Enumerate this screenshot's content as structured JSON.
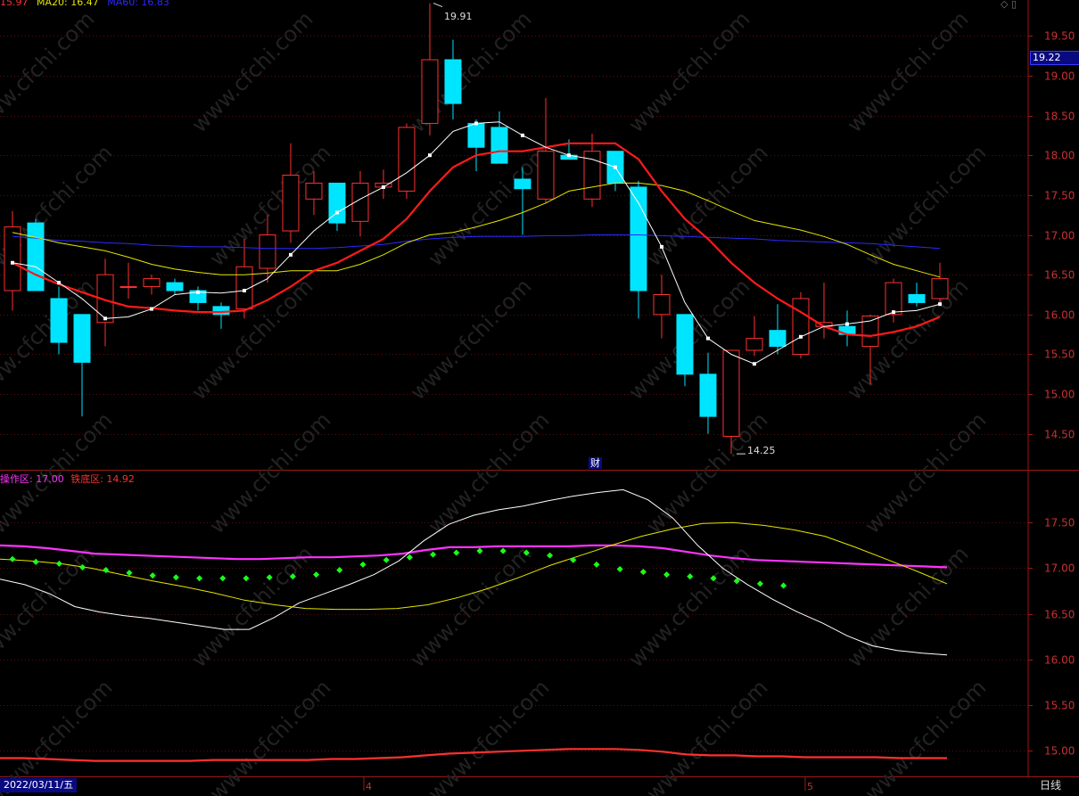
{
  "chart_data": [
    {
      "type": "candlestick",
      "legend": [
        {
          "label": "15.97",
          "color": "#ff3030"
        },
        {
          "label": "MA20: 16.47",
          "color": "#e6e600"
        },
        {
          "label": "MA60: 16.83",
          "color": "#2a2aff"
        }
      ],
      "current_price_label": "19.22",
      "max_label": "19.91",
      "min_label": "14.25",
      "finance_marker": "财",
      "y_ticks": [
        "19.50",
        "19.00",
        "18.50",
        "18.00",
        "17.50",
        "17.00",
        "16.50",
        "16.00",
        "15.50",
        "15.00",
        "14.50"
      ],
      "ylim": [
        14.05,
        19.95
      ],
      "colors": {
        "up": "#ff3030",
        "down": "#00e5ff",
        "ma5": "#ffffff",
        "ma10": "#ff1a1a",
        "ma20": "#e6e600",
        "ma60": "#2a2aff"
      },
      "candles": [
        {
          "o": 16.3,
          "h": 17.3,
          "l": 16.05,
          "c": 17.1
        },
        {
          "o": 17.15,
          "h": 17.2,
          "l": 16.3,
          "c": 16.3
        },
        {
          "o": 16.2,
          "h": 16.35,
          "l": 15.5,
          "c": 15.65
        },
        {
          "o": 16.0,
          "h": 16.0,
          "l": 14.72,
          "c": 15.4
        },
        {
          "o": 15.9,
          "h": 16.7,
          "l": 15.6,
          "c": 16.5
        },
        {
          "o": 16.35,
          "h": 16.65,
          "l": 16.2,
          "c": 16.35
        },
        {
          "o": 16.35,
          "h": 16.5,
          "l": 16.25,
          "c": 16.45
        },
        {
          "o": 16.4,
          "h": 16.45,
          "l": 16.25,
          "c": 16.3
        },
        {
          "o": 16.3,
          "h": 16.35,
          "l": 16.05,
          "c": 16.15
        },
        {
          "o": 16.1,
          "h": 16.15,
          "l": 15.82,
          "c": 16.0
        },
        {
          "o": 16.07,
          "h": 16.95,
          "l": 15.95,
          "c": 16.6
        },
        {
          "o": 16.58,
          "h": 17.25,
          "l": 16.4,
          "c": 17.0
        },
        {
          "o": 17.05,
          "h": 18.15,
          "l": 16.9,
          "c": 17.75
        },
        {
          "o": 17.45,
          "h": 17.8,
          "l": 17.25,
          "c": 17.65
        },
        {
          "o": 17.65,
          "h": 17.65,
          "l": 17.05,
          "c": 17.15
        },
        {
          "o": 17.17,
          "h": 17.8,
          "l": 16.98,
          "c": 17.65
        },
        {
          "o": 17.6,
          "h": 17.82,
          "l": 17.45,
          "c": 17.65
        },
        {
          "o": 17.55,
          "h": 18.4,
          "l": 17.45,
          "c": 18.35
        },
        {
          "o": 18.4,
          "h": 19.91,
          "l": 18.25,
          "c": 19.2
        },
        {
          "o": 19.2,
          "h": 19.45,
          "l": 18.45,
          "c": 18.65
        },
        {
          "o": 18.4,
          "h": 18.45,
          "l": 17.8,
          "c": 18.1
        },
        {
          "o": 18.35,
          "h": 18.55,
          "l": 17.9,
          "c": 17.9
        },
        {
          "o": 17.7,
          "h": 17.85,
          "l": 17.0,
          "c": 17.58
        },
        {
          "o": 17.45,
          "h": 18.72,
          "l": 17.4,
          "c": 18.05
        },
        {
          "o": 18.0,
          "h": 18.2,
          "l": 17.95,
          "c": 17.95
        },
        {
          "o": 17.45,
          "h": 18.27,
          "l": 17.35,
          "c": 18.05
        },
        {
          "o": 18.05,
          "h": 18.05,
          "l": 17.55,
          "c": 17.65
        },
        {
          "o": 17.6,
          "h": 17.68,
          "l": 15.95,
          "c": 16.3
        },
        {
          "o": 16.0,
          "h": 16.5,
          "l": 15.7,
          "c": 16.25
        },
        {
          "o": 16.0,
          "h": 16.0,
          "l": 15.1,
          "c": 15.25
        },
        {
          "o": 15.25,
          "h": 15.52,
          "l": 14.5,
          "c": 14.72
        },
        {
          "o": 14.47,
          "h": 15.55,
          "l": 14.25,
          "c": 15.55
        },
        {
          "o": 15.55,
          "h": 15.98,
          "l": 15.48,
          "c": 15.7
        },
        {
          "o": 15.8,
          "h": 16.13,
          "l": 15.5,
          "c": 15.6
        },
        {
          "o": 15.5,
          "h": 16.28,
          "l": 15.45,
          "c": 16.2
        },
        {
          "o": 15.85,
          "h": 16.4,
          "l": 15.7,
          "c": 15.9
        },
        {
          "o": 15.85,
          "h": 16.05,
          "l": 15.6,
          "c": 15.75
        },
        {
          "o": 15.6,
          "h": 16.0,
          "l": 15.12,
          "c": 15.98
        },
        {
          "o": 16.0,
          "h": 16.45,
          "l": 15.9,
          "c": 16.4
        },
        {
          "o": 16.25,
          "h": 16.4,
          "l": 16.1,
          "c": 16.15
        },
        {
          "o": 16.2,
          "h": 16.65,
          "l": 16.15,
          "c": 16.45
        }
      ],
      "ma5": [
        16.65,
        16.6,
        16.4,
        16.2,
        15.95,
        15.97,
        16.07,
        16.25,
        16.28,
        16.27,
        16.3,
        16.45,
        16.75,
        17.05,
        17.28,
        17.45,
        17.6,
        17.78,
        18.0,
        18.3,
        18.4,
        18.42,
        18.25,
        18.1,
        18.0,
        17.95,
        17.85,
        17.4,
        16.85,
        16.15,
        15.7,
        15.5,
        15.38,
        15.55,
        15.72,
        15.85,
        15.88,
        15.92,
        16.03,
        16.05,
        16.13
      ],
      "ma10": [
        16.65,
        16.5,
        16.38,
        16.28,
        16.18,
        16.1,
        16.08,
        16.05,
        16.03,
        16.03,
        16.05,
        16.18,
        16.35,
        16.55,
        16.65,
        16.8,
        16.95,
        17.2,
        17.55,
        17.85,
        18.0,
        18.05,
        18.05,
        18.1,
        18.15,
        18.15,
        18.15,
        17.95,
        17.55,
        17.2,
        16.95,
        16.65,
        16.4,
        16.2,
        16.03,
        15.85,
        15.75,
        15.73,
        15.78,
        15.85,
        15.97
      ],
      "ma20": [
        17.03,
        16.97,
        16.9,
        16.85,
        16.8,
        16.72,
        16.63,
        16.57,
        16.53,
        16.5,
        16.5,
        16.52,
        16.55,
        16.55,
        16.55,
        16.63,
        16.75,
        16.9,
        17.0,
        17.03,
        17.1,
        17.18,
        17.28,
        17.4,
        17.55,
        17.6,
        17.65,
        17.65,
        17.62,
        17.55,
        17.43,
        17.3,
        17.18,
        17.12,
        17.06,
        16.98,
        16.88,
        16.75,
        16.63,
        16.55,
        16.47
      ],
      "ma60": [
        16.98,
        16.96,
        16.93,
        16.92,
        16.9,
        16.89,
        16.87,
        16.86,
        16.85,
        16.85,
        16.84,
        16.83,
        16.83,
        16.83,
        16.84,
        16.86,
        16.88,
        16.92,
        16.95,
        16.97,
        16.98,
        16.98,
        16.98,
        16.99,
        16.99,
        17.0,
        17.0,
        17.0,
        16.99,
        16.98,
        16.97,
        16.96,
        16.95,
        16.93,
        16.92,
        16.91,
        16.9,
        16.89,
        16.87,
        16.85,
        16.83
      ]
    },
    {
      "type": "line",
      "legend": [
        {
          "label": "操作区: 17.00",
          "color": "#ff33ff"
        },
        {
          "label": "铁底区: 14.92",
          "color": "#ff3030"
        }
      ],
      "y_ticks": [
        "17.50",
        "17.00",
        "16.50",
        "16.00",
        "15.50",
        "15.00"
      ],
      "ylim": [
        14.72,
        18.03
      ],
      "series": [
        {
          "name": "操作区",
          "color": "#ff33ff",
          "values": [
            17.25,
            17.24,
            17.22,
            17.19,
            17.16,
            17.15,
            17.14,
            17.13,
            17.12,
            17.11,
            17.1,
            17.1,
            17.11,
            17.12,
            17.12,
            17.13,
            17.14,
            17.16,
            17.2,
            17.23,
            17.23,
            17.24,
            17.24,
            17.24,
            17.24,
            17.25,
            17.25,
            17.24,
            17.22,
            17.18,
            17.14,
            17.11,
            17.09,
            17.08,
            17.07,
            17.06,
            17.05,
            17.04,
            17.03,
            17.02,
            17.01
          ]
        },
        {
          "name": "铁底区",
          "color": "#ff3030",
          "values": [
            14.92,
            14.92,
            14.91,
            14.9,
            14.89,
            14.89,
            14.89,
            14.89,
            14.89,
            14.9,
            14.9,
            14.9,
            14.9,
            14.9,
            14.91,
            14.91,
            14.92,
            14.93,
            14.95,
            14.97,
            14.98,
            14.99,
            15.0,
            15.01,
            15.02,
            15.02,
            15.02,
            15.01,
            14.99,
            14.96,
            14.95,
            14.95,
            14.94,
            14.94,
            14.93,
            14.93,
            14.93,
            14.93,
            14.92,
            14.92,
            14.92
          ]
        },
        {
          "color": "#ffffff",
          "values": [
            16.88,
            16.82,
            16.72,
            16.58,
            16.52,
            16.48,
            16.45,
            16.41,
            16.37,
            16.33,
            16.33,
            16.46,
            16.62,
            16.72,
            16.82,
            16.93,
            17.08,
            17.3,
            17.48,
            17.58,
            17.64,
            17.68,
            17.74,
            17.79,
            17.83,
            17.86,
            17.75,
            17.55,
            17.25,
            17.0,
            16.82,
            16.66,
            16.52,
            16.4,
            16.26,
            16.15,
            16.1,
            16.07,
            16.05
          ]
        },
        {
          "color": "#e6e600",
          "values": [
            17.1,
            17.08,
            17.05,
            17.0,
            16.93,
            16.86,
            16.8,
            16.73,
            16.65,
            16.6,
            16.56,
            16.55,
            16.55,
            16.56,
            16.6,
            16.68,
            16.78,
            16.9,
            17.03,
            17.14,
            17.25,
            17.35,
            17.43,
            17.49,
            17.5,
            17.47,
            17.42,
            17.35,
            17.23,
            17.1,
            16.97,
            16.83
          ]
        },
        {
          "color": "#1aff1a",
          "dotted": true,
          "values": [
            17.1,
            17.07,
            17.05,
            17.01,
            16.98,
            16.95,
            16.92,
            16.9,
            16.89,
            16.89,
            16.89,
            16.9,
            16.91,
            16.93,
            16.98,
            17.04,
            17.09,
            17.12,
            17.15,
            17.17,
            17.19,
            17.19,
            17.17,
            17.14,
            17.09,
            17.04,
            16.99,
            16.96,
            16.93,
            16.91,
            16.89,
            16.86,
            16.83,
            16.81
          ]
        }
      ]
    }
  ],
  "axis_markers": [
    "4",
    "5"
  ],
  "footer": {
    "date": "2022/03/11/五",
    "period": "日线"
  }
}
